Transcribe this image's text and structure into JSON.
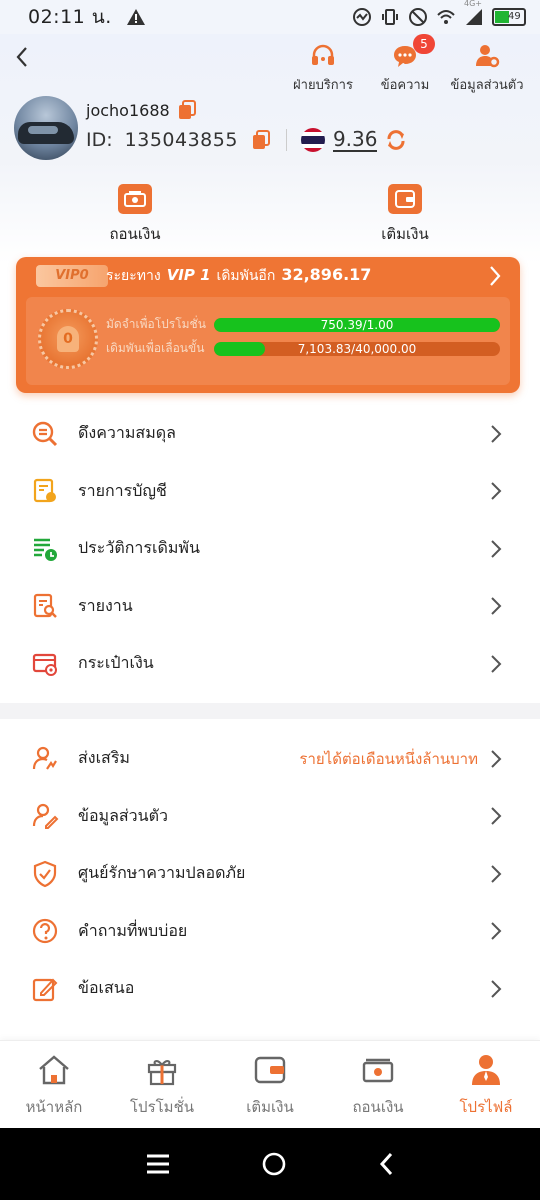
{
  "status_bar": {
    "time": "02:11 น.",
    "network": "4G+",
    "battery": "49"
  },
  "header": {
    "actions": [
      {
        "label": "ฝ่ายบริการ",
        "icon": "headset-icon"
      },
      {
        "label": "ข้อความ",
        "icon": "message-icon",
        "badge": "5"
      },
      {
        "label": "ข้อมูลส่วนตัว",
        "icon": "user-settings-icon"
      }
    ]
  },
  "profile": {
    "username": "jocho1688",
    "id_label": "ID:",
    "id_value": "135043855",
    "balance": "9.36"
  },
  "quick_actions": [
    {
      "label": "ถอนเงิน",
      "icon": "withdraw-icon"
    },
    {
      "label": "เติมเงิน",
      "icon": "wallet-icon"
    }
  ],
  "vip": {
    "current_level": "VIP0",
    "distance_label": "ระยะทาง",
    "next_level": "VIP 1",
    "bet_more_label": "เดิมพันอีก",
    "bet_more_amount": "32,896.17",
    "medal_number": "0",
    "progress": [
      {
        "label": "มัดจำเพื่อโปรโมชั่น",
        "text": "750.39/1.00",
        "fraction": 1.0
      },
      {
        "label": "เดิมพันเพื่อเลื่อนขั้น",
        "text": "7,103.83/40,000.00",
        "fraction": 0.178
      }
    ]
  },
  "menu_section_1": [
    {
      "label": "ดึงความสมดุล",
      "icon": "coin-search-icon"
    },
    {
      "label": "รายการบัญชี",
      "icon": "account-statement-icon"
    },
    {
      "label": "ประวัติการเดิมพัน",
      "icon": "bet-history-icon"
    },
    {
      "label": "รายงาน",
      "icon": "report-icon"
    },
    {
      "label": "กระเป๋าเงิน",
      "icon": "wallet-settings-icon"
    }
  ],
  "menu_section_2": [
    {
      "label": "ส่งเสริม",
      "icon": "promote-icon",
      "extra": "รายได้ต่อเดือนหนึ่งล้านบาท"
    },
    {
      "label": "ข้อมูลส่วนตัว",
      "icon": "user-edit-icon"
    },
    {
      "label": "ศูนย์รักษาความปลอดภัย",
      "icon": "shield-icon"
    },
    {
      "label": "คำถามที่พบบ่อย",
      "icon": "question-icon"
    },
    {
      "label": "ข้อเสนอ",
      "icon": "edit-icon"
    }
  ],
  "bottom_nav": [
    {
      "label": "หน้าหลัก",
      "icon": "home-icon",
      "active": false
    },
    {
      "label": "โปรโมชั่น",
      "icon": "gift-icon",
      "active": false
    },
    {
      "label": "เติมเงิน",
      "icon": "wallet-icon",
      "active": false
    },
    {
      "label": "ถอนเงิน",
      "icon": "withdraw-icon",
      "active": false
    },
    {
      "label": "โปรไฟล์",
      "icon": "profile-icon",
      "active": true
    }
  ],
  "colors": {
    "accent": "#ED7133",
    "progress_green": "#17C21D",
    "badge_red": "#F04636"
  }
}
